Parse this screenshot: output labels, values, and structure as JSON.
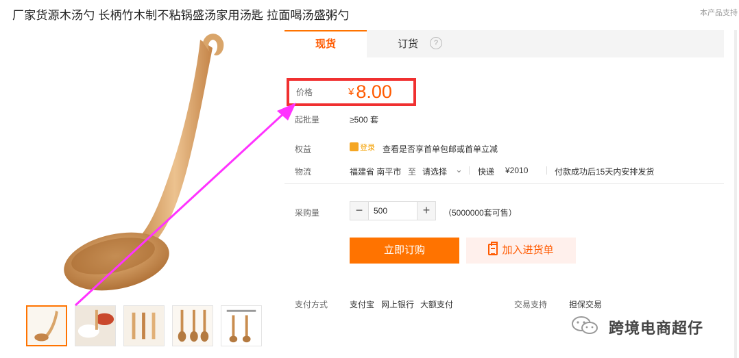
{
  "product": {
    "title": "厂家货源木汤勺 长柄竹木制不粘锅盛汤家用汤匙 拉面喝汤盛粥勺",
    "top_note": "本产品支持"
  },
  "tabs": [
    {
      "label": "现货",
      "active": true
    },
    {
      "label": "订货",
      "active": false
    }
  ],
  "help_icon": "?",
  "price": {
    "label": "价格",
    "currency": "¥",
    "value": "8.00"
  },
  "min_order": {
    "label": "起批量",
    "value": "≥500 套"
  },
  "benefits": {
    "label": "权益",
    "badge": "登录",
    "text": "查看是否享首单包邮或首单立减"
  },
  "logistics": {
    "label": "物流",
    "from": "福建省 南平市",
    "to_word": "至",
    "destination": "请选择",
    "method": "快递",
    "fee": "¥2010",
    "note": "付款成功后15天内安排发货"
  },
  "quantity": {
    "label": "采购量",
    "minus": "−",
    "plus": "+",
    "value": "500",
    "available": "（5000000套可售）"
  },
  "buttons": {
    "buy": "立即订购",
    "cart": "加入进货单"
  },
  "payment": {
    "label": "支付方式",
    "methods": [
      "支付宝",
      "网上银行",
      "大额支付"
    ]
  },
  "trade": {
    "label": "交易支持",
    "value": "担保交易"
  },
  "watermark": {
    "text": "跨境电商超仔"
  },
  "colors": {
    "accent": "#ff7300",
    "price": "#ff5a00",
    "highlight_box": "#f03030",
    "arrow": "#ff33ff"
  },
  "icons": [
    "help-icon",
    "login-badge-icon",
    "chevron-down-icon",
    "minus-icon",
    "plus-icon",
    "clipboard-icon",
    "wechat-icon"
  ]
}
